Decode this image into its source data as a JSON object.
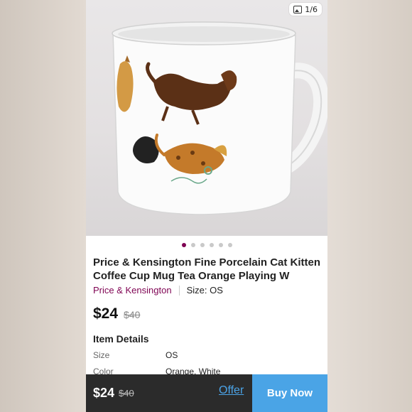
{
  "gallery": {
    "counter": "1/6",
    "counter_icon": "image-icon",
    "dot_count": 6,
    "active_dot": 0
  },
  "listing": {
    "title": "Price & Kensington Fine Porcelain Cat Kitten Coffee Cup Mug Tea Orange Playing W",
    "brand": "Price & Kensington",
    "size_label": "Size: OS",
    "price": "$24",
    "original_price": "$40"
  },
  "details": {
    "heading": "Item Details",
    "rows": [
      {
        "label": "Size",
        "value": "OS"
      },
      {
        "label": "Color",
        "value": "Orange, White"
      }
    ]
  },
  "bottom_bar": {
    "price": "$24",
    "original_price": "$40",
    "offer_label": "Offer",
    "buy_label": "Buy Now"
  },
  "colors": {
    "brand": "#7f0353",
    "accent": "#4aa4e6",
    "bar_bg": "#2b2b2b"
  }
}
